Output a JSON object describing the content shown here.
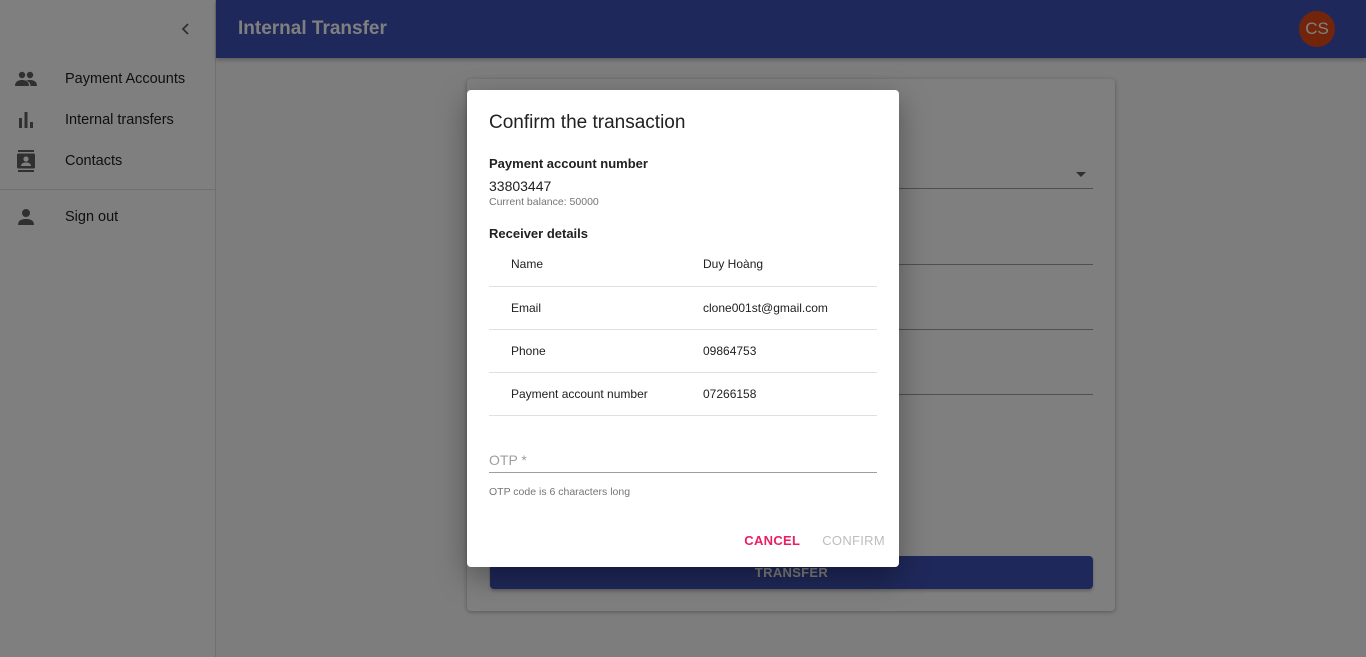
{
  "app": {
    "title": "Internal Transfer",
    "avatar_initials": "CS"
  },
  "drawer": {
    "items": [
      {
        "label": "Payment Accounts",
        "icon": "people-icon"
      },
      {
        "label": "Internal transfers",
        "icon": "bar-chart-icon"
      },
      {
        "label": "Contacts",
        "icon": "contacts-icon"
      }
    ],
    "signout": {
      "label": "Sign out",
      "icon": "person-icon"
    }
  },
  "form": {
    "transfer_label": "TRANSFER"
  },
  "dialog": {
    "title": "Confirm the transaction",
    "payment_account_label": "Payment account number",
    "payment_account_number": "33803447",
    "current_balance": "Current balance: 50000",
    "receiver_label": "Receiver details",
    "receiver": [
      {
        "key": "Name",
        "value": "Duy Hoàng"
      },
      {
        "key": "Email",
        "value": "clone001st@gmail.com"
      },
      {
        "key": "Phone",
        "value": "09864753"
      },
      {
        "key": "Payment account number",
        "value": "07266158"
      }
    ],
    "otp_label": "OTP *",
    "otp_help": "OTP code is 6 characters long",
    "cancel_label": "CANCEL",
    "confirm_label": "CONFIRM"
  },
  "colors": {
    "primary": "#3f51b5",
    "accent": "#e91e63",
    "avatar": "#e64a19"
  }
}
